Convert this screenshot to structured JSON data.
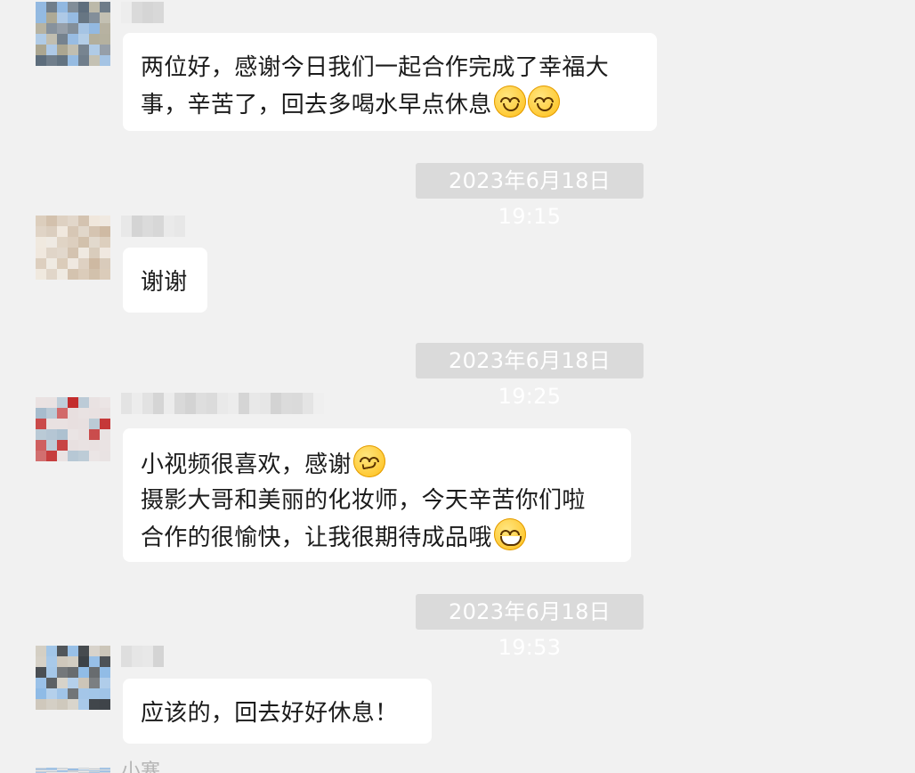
{
  "conversation": {
    "messages": [
      {
        "type": "message",
        "avatar_colors": [
          "#8fb7e0",
          "#5b6b7a",
          "#a9a48f"
        ],
        "lines": [
          "两位好，感谢今日我们一起合作完成了幸福大",
          "事，辛苦了，回去多喝水早点休息"
        ],
        "emoji": [
          "smile",
          "smile"
        ]
      },
      {
        "type": "timestamp",
        "text": "2023年6月18日 19:15"
      },
      {
        "type": "message",
        "avatar_colors": [
          "#d9c9b6",
          "#cdb8a0",
          "#efe6db"
        ],
        "lines": [
          "谢谢"
        ],
        "emoji": []
      },
      {
        "type": "timestamp",
        "text": "2023年6月18日 19:25"
      },
      {
        "type": "message",
        "avatar_colors": [
          "#c22a2a",
          "#9fb7c9",
          "#e7dede"
        ],
        "lines": [
          "小视频很喜欢，感谢",
          "摄影大哥和美丽的化妆师，今天辛苦你们啦",
          "合作的很愉快，让我很期待成品哦"
        ],
        "emoji": [
          "smirk",
          "grin"
        ]
      },
      {
        "type": "timestamp",
        "text": "2023年6月18日 19:53"
      },
      {
        "type": "message",
        "avatar_colors": [
          "#8fbbe6",
          "#2d3338",
          "#c9c2b4"
        ],
        "lines": [
          "应该的，回去好好休息！"
        ],
        "emoji": []
      }
    ],
    "partial_next_name": "小塞"
  },
  "colors": {
    "background": "#f1f1f1",
    "bubble": "#ffffff",
    "text": "#1b1b1b",
    "timestamp_bg": "#dadada",
    "timestamp_text": "#ffffff"
  }
}
